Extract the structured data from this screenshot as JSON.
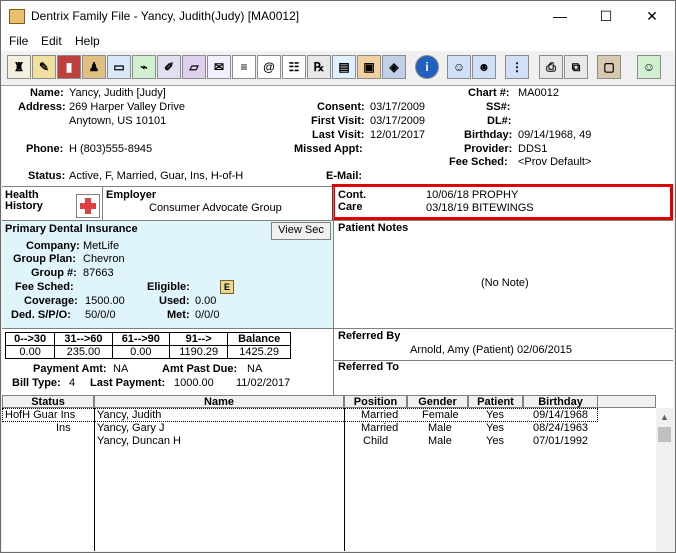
{
  "window": {
    "title": "Dentrix Family File - Yancy, Judith(Judy) [MA0012]",
    "minimize": "—",
    "maximize": "☐",
    "close": "✕"
  },
  "menu": [
    "File",
    "Edit",
    "Help"
  ],
  "patient": {
    "name_label": "Name:",
    "name": "Yancy, Judith [Judy]",
    "address_label": "Address:",
    "address1": "269 Harper Valley Drive",
    "address2": "Anytown, US  10101",
    "phone_label": "Phone:",
    "phone": "H (803)555-8945",
    "status_label": "Status:",
    "status": "Active, F, Married, Guar, Ins, H-of-H",
    "consent_label": "Consent:",
    "consent": "03/17/2009",
    "first_visit_label": "First Visit:",
    "first_visit": "03/17/2009",
    "last_visit_label": "Last Visit:",
    "last_visit": "12/01/2017",
    "missed_label": "Missed Appt:",
    "email_label": "E-Mail:",
    "chart_label": "Chart #:",
    "chart": "MA0012",
    "ss_label": "SS#:",
    "dl_label": "DL#:",
    "birthday_label": "Birthday:",
    "birthday": "09/14/1968, 49",
    "provider_label": "Provider:",
    "provider": "DDS1",
    "fee_label": "Fee Sched:",
    "fee": "<Prov Default>"
  },
  "health": {
    "label1": "Health",
    "label2": "History"
  },
  "employer": {
    "label": "Employer",
    "value": "Consumer Advocate Group"
  },
  "care": {
    "label1": "Cont.",
    "label2": "Care",
    "line1": "10/06/18 PROPHY",
    "line2": "03/18/19 BITEWINGS"
  },
  "insurance": {
    "title": "Primary Dental Insurance",
    "view_sec": "View Sec",
    "company_label": "Company:",
    "company": "MetLife",
    "group_plan_label": "Group Plan:",
    "group_plan": "Chevron",
    "group_label": "Group #:",
    "group": "87663",
    "fee_label": "Fee Sched:",
    "eligible_label": "Eligible:",
    "eligible_icon": "E",
    "coverage_label": "Coverage:",
    "coverage": "1500.00",
    "used_label": "Used:",
    "used": "0.00",
    "ded_label": "Ded. S/P/O:",
    "ded": "50/0/0",
    "met_label": "Met:",
    "met": "0/0/0"
  },
  "notes": {
    "title": "Patient Notes",
    "empty": "(No Note)"
  },
  "balance": {
    "headers": [
      "0-->30",
      "31-->60",
      "61-->90",
      "91-->",
      "Balance"
    ],
    "values": [
      "0.00",
      "235.00",
      "0.00",
      "1190.29",
      "1425.29"
    ],
    "payment_amt_label": "Payment Amt:",
    "payment_amt": "NA",
    "past_due_label": "Amt Past Due:",
    "past_due": "NA",
    "bill_type_label": "Bill Type:",
    "bill_type": "4",
    "last_payment_label": "Last Payment:",
    "last_payment": "1000.00",
    "last_payment_date": "11/02/2017"
  },
  "referred_by": {
    "title": "Referred By",
    "value": "Arnold, Amy (Patient) 02/06/2015"
  },
  "referred_to": {
    "title": "Referred To"
  },
  "family": {
    "headers": [
      "Status",
      "Name",
      "Position",
      "Gender",
      "Patient",
      "Birthday"
    ],
    "rows": [
      {
        "status": "HofH Guar Ins",
        "name": "Yancy, Judith",
        "position": "Married",
        "gender": "Female",
        "patient": "Yes",
        "birthday": "09/14/1968"
      },
      {
        "status": "Ins",
        "name": "Yancy, Gary J",
        "position": "Married",
        "gender": "Male",
        "patient": "Yes",
        "birthday": "08/24/1963"
      },
      {
        "status": "",
        "name": "Yancy, Duncan H",
        "position": "Child",
        "gender": "Male",
        "patient": "Yes",
        "birthday": "07/01/1992"
      }
    ]
  },
  "toolbar_icons": [
    "tooth-icon",
    "notes-icon",
    "book-icon",
    "chair-icon",
    "card-icon",
    "hygiene-icon",
    "pen-icon",
    "eraser-icon",
    "letter-icon",
    "email-icon",
    "list-icon",
    "rx-icon",
    "document-icon",
    "stamp-icon",
    "box-icon",
    "info-icon",
    "family-add-icon",
    "family-icon",
    "tree-icon",
    "printer-icon",
    "copy-icon",
    "photo-icon",
    "picture-icon",
    "person-icon"
  ]
}
